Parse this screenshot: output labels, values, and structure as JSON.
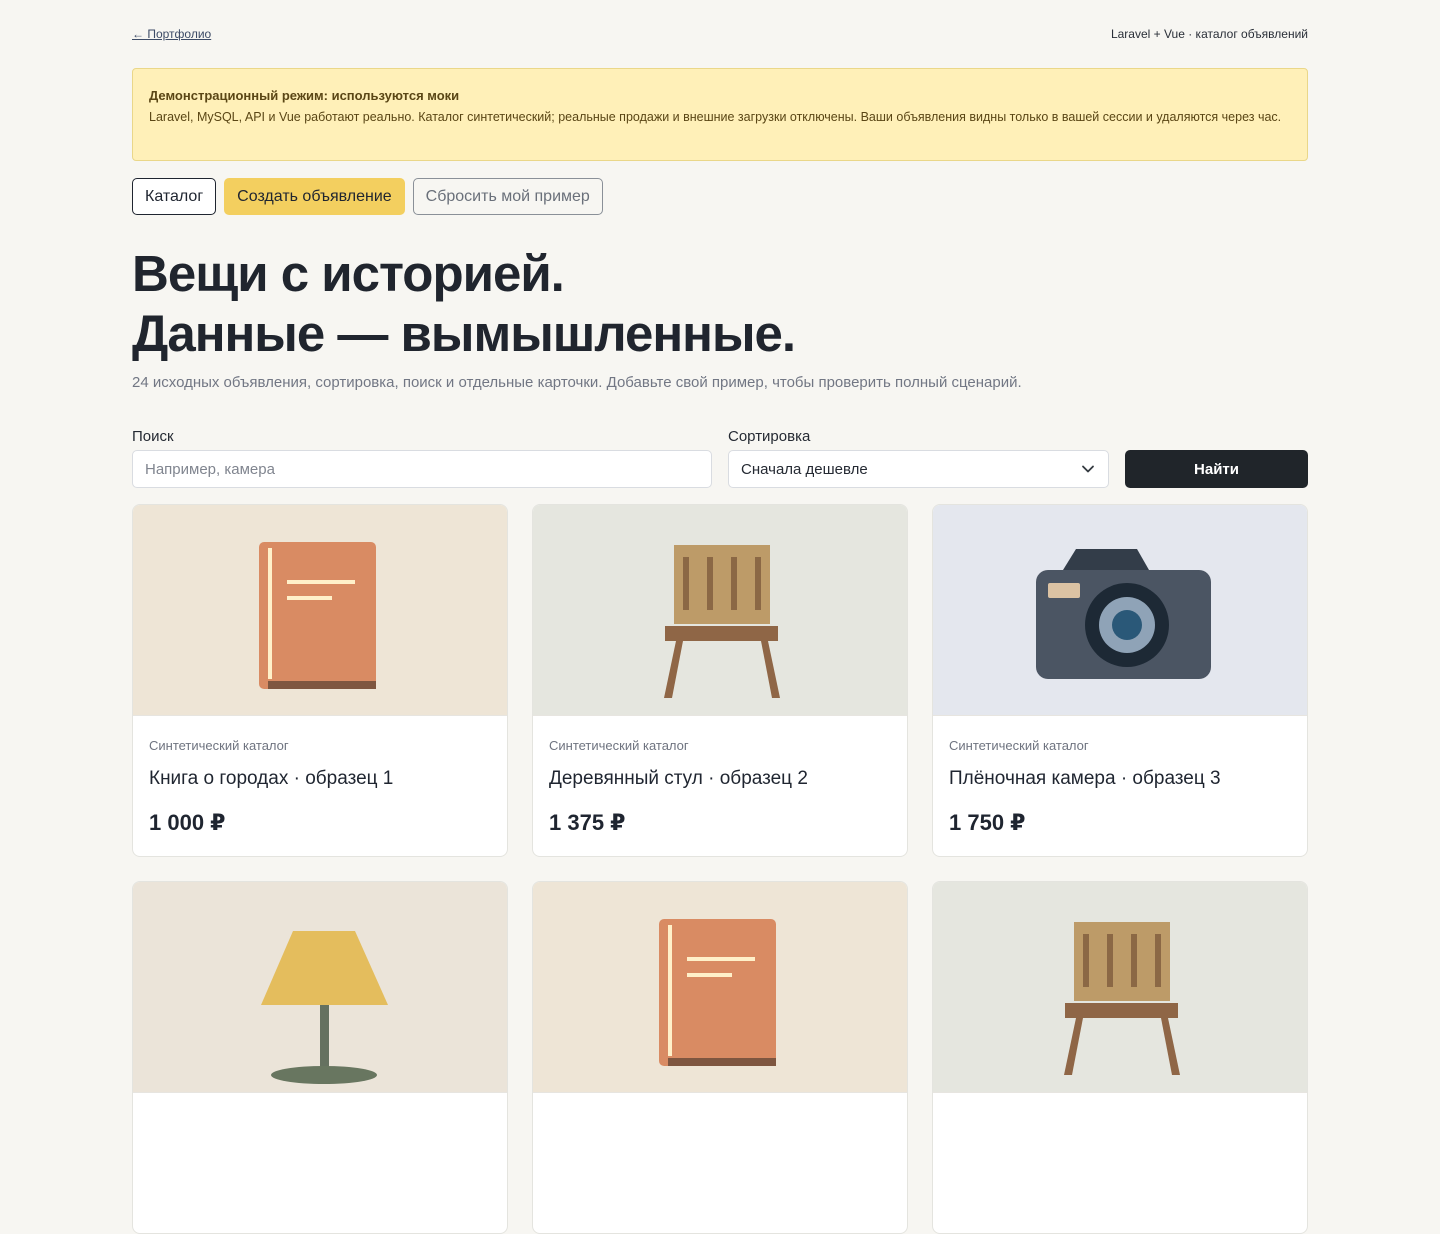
{
  "header": {
    "portfolio_link": "← Портфолио",
    "project_title": "Laravel + Vue · каталог объявлений"
  },
  "demo": {
    "title": "Демонстрационный режим: используются моки",
    "text": "Laravel, MySQL, API и Vue работают реально. Каталог синтетический; реальные продажи и внешние загрузки отключены. Ваши объявления видны только в вашей сессии и удаляются через час."
  },
  "actions": {
    "catalog": "Каталог",
    "create": "Создать объявление",
    "reset": "Сбросить мой пример"
  },
  "hero": {
    "line1": "Вещи с историей.",
    "line2": "Данные — вымышленные.",
    "subtitle": "24 исходных объявления, сортировка, поиск и отдельные карточки. Добавьте свой пример, чтобы проверить полный сценарий."
  },
  "filters": {
    "search_label": "Поиск",
    "search_placeholder": "Например, камера",
    "search_value": "",
    "sort_label": "Сортировка",
    "sort_value": "Сначала дешевле",
    "submit": "Найти"
  },
  "cards": [
    {
      "category": "Синтетический каталог",
      "title": "Книга о городах · образец 1",
      "price": "1 000 ₽",
      "icon": "book-icon",
      "bg": "#eee5d6"
    },
    {
      "category": "Синтетический каталог",
      "title": "Деревянный стул · образец 2",
      "price": "1 375 ₽",
      "icon": "chair-icon",
      "bg": "#e5e6df"
    },
    {
      "category": "Синтетический каталог",
      "title": "Плёночная камера · образец 3",
      "price": "1 750 ₽",
      "icon": "camera-icon",
      "bg": "#e4e7ee"
    },
    {
      "category": "",
      "title": "",
      "price": "",
      "icon": "lamp-icon",
      "bg": "#ebe4d9"
    },
    {
      "category": "",
      "title": "",
      "price": "",
      "icon": "book-icon",
      "bg": "#eee5d6"
    },
    {
      "category": "",
      "title": "",
      "price": "",
      "icon": "chair-icon",
      "bg": "#e5e6df"
    }
  ],
  "colors": {
    "page_bg": "#f7f6f2",
    "accent": "#f3cf5f",
    "banner_bg": "#fff0b8",
    "dark_button": "#20252a"
  }
}
